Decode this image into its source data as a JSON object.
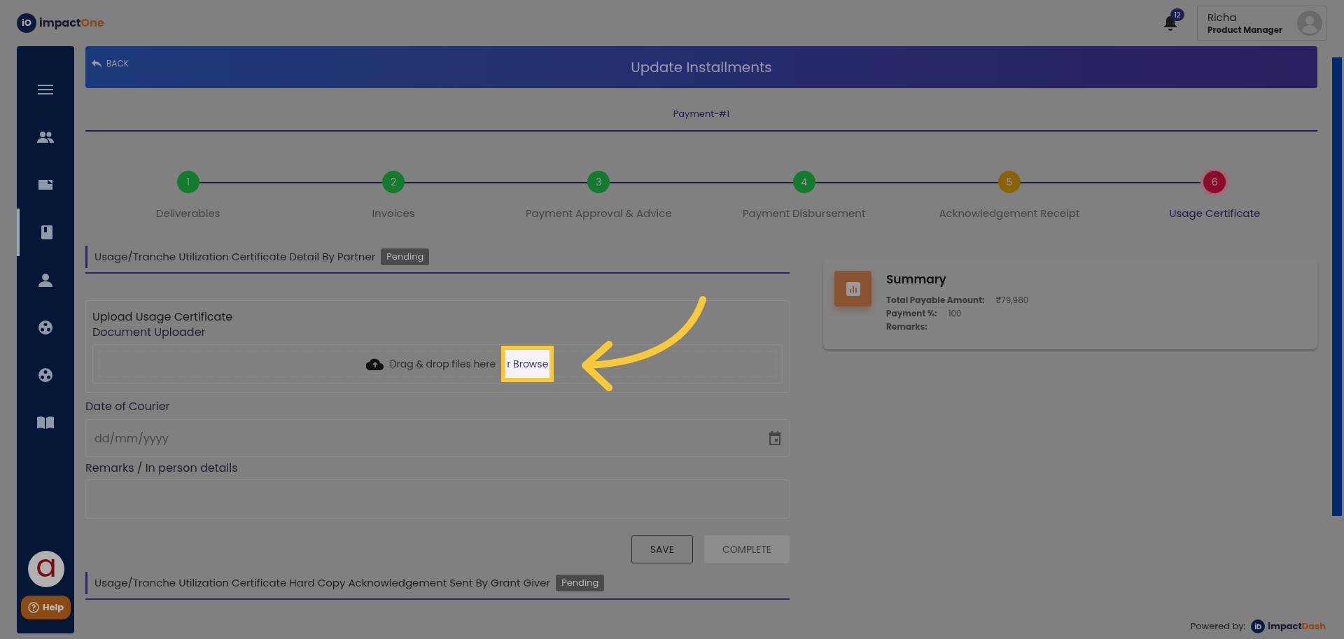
{
  "header": {
    "logo_mark": "iO",
    "logo_text_1": "impact",
    "logo_text_2": "One",
    "notification_count": "12",
    "user": {
      "name": "Richa",
      "role": "Product Manager"
    }
  },
  "sidebar": {
    "items": [
      {
        "kind": "menu",
        "selected": false
      },
      {
        "kind": "people",
        "selected": false
      },
      {
        "kind": "folder",
        "selected": false
      },
      {
        "kind": "book",
        "selected": true
      },
      {
        "kind": "person",
        "selected": false
      },
      {
        "kind": "group",
        "selected": false
      },
      {
        "kind": "group",
        "selected": false
      },
      {
        "kind": "reader",
        "selected": false
      }
    ],
    "avatar_letter": "a",
    "help": "Help"
  },
  "banner": {
    "back": "BACK",
    "title": "Update Installments"
  },
  "payment_tab": "Payment-#1",
  "steps": [
    {
      "number": "1",
      "label": "Deliverables",
      "color": "#137a2e",
      "selected": false
    },
    {
      "number": "2",
      "label": "Invoices",
      "color": "#137a2e",
      "selected": false
    },
    {
      "number": "3",
      "label": "Payment Approval & Advice",
      "color": "#137a2e",
      "selected": false
    },
    {
      "number": "4",
      "label": "Payment Disbursement",
      "color": "#137a2e",
      "selected": false
    },
    {
      "number": "5",
      "label": "Acknowledgement Receipt",
      "color": "#8a6208",
      "selected": false
    },
    {
      "number": "6",
      "label": "Usage Certificate",
      "color": "#8c0a2e",
      "selected": true
    }
  ],
  "section1": {
    "title": "Usage/Tranche Utilization Certificate Detail By Partner",
    "status": "Pending"
  },
  "upload": {
    "title": "Upload Usage Certificate",
    "subtitle": "Document Uploader",
    "drop_text": "Drag & drop files here",
    "browse": "r Browse"
  },
  "date_field": {
    "label": "Date of Courier",
    "placeholder": "dd/mm/yyyy"
  },
  "remarks_field": {
    "label": "Remarks / In person details"
  },
  "buttons": [
    {
      "label": "SAVE",
      "disabled": false
    },
    {
      "label": "COMPLETE",
      "disabled": true
    }
  ],
  "section2": {
    "title": "Usage/Tranche Utilization Certificate Hard Copy Acknowledgement Sent By Grant Giver",
    "status": "Pending"
  },
  "summary": {
    "title": "Summary",
    "rows": [
      {
        "label": "Total Payable Amount:",
        "value": "₹79,980"
      },
      {
        "label": "Payment %:",
        "value": "100"
      },
      {
        "label": "Remarks:"
      }
    ]
  },
  "footer": {
    "powered_by": "Powered by:",
    "brand_mark": "iD",
    "brand_1": "impact",
    "brand_2": "Dash"
  }
}
